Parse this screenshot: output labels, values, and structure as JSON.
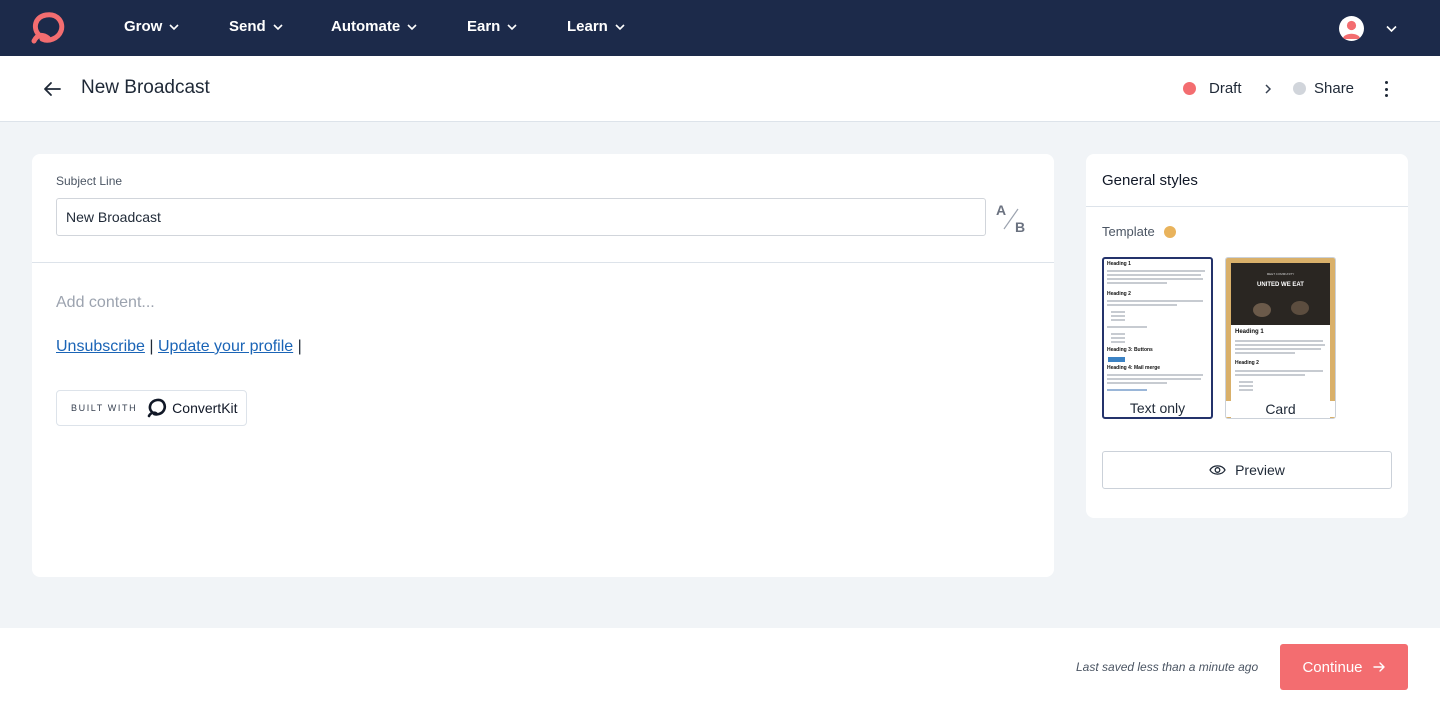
{
  "app": {
    "brand_color": "#f36d70",
    "nav_bg": "#1c2a4a"
  },
  "nav": {
    "items": [
      {
        "label": "Grow"
      },
      {
        "label": "Send"
      },
      {
        "label": "Automate"
      },
      {
        "label": "Earn"
      },
      {
        "label": "Learn"
      }
    ],
    "logo_icon": "convertkit-logo-icon",
    "avatar_icon": "user-avatar-icon"
  },
  "header": {
    "title": "New Broadcast",
    "steps": [
      {
        "label": "Draft",
        "color": "#f36d70",
        "active": true
      },
      {
        "label": "Share",
        "color": "#d1d5db",
        "active": false
      }
    ]
  },
  "editor": {
    "subject_label": "Subject Line",
    "subject_value": "New Broadcast",
    "ab_a": "A",
    "ab_b": "B",
    "content_placeholder": "Add content...",
    "unsubscribe_label": "Unsubscribe",
    "separator": "|",
    "update_profile_label": "Update your profile",
    "built_with_label": "BUILT WITH",
    "built_with_brand": "ConvertKit"
  },
  "styles_panel": {
    "title": "General styles",
    "template_label": "Template",
    "template_dot_color": "#e9b35c",
    "templates": [
      {
        "name": "Text only",
        "selected": true,
        "preview": {
          "heading1": "Heading 1",
          "heading2": "Heading 2",
          "heading3": "Heading 3: Buttons",
          "heading4": "Heading 4: Mail merge"
        }
      },
      {
        "name": "Card",
        "selected": false,
        "preview": {
          "eyebrow": "MEET COMMUNITY",
          "hero_title": "UNITED WE EAT",
          "heading1": "Heading 1",
          "heading2": "Heading 2"
        }
      }
    ],
    "preview_button": "Preview"
  },
  "footer": {
    "saved_text": "Last saved less than a minute ago",
    "continue_label": "Continue"
  }
}
